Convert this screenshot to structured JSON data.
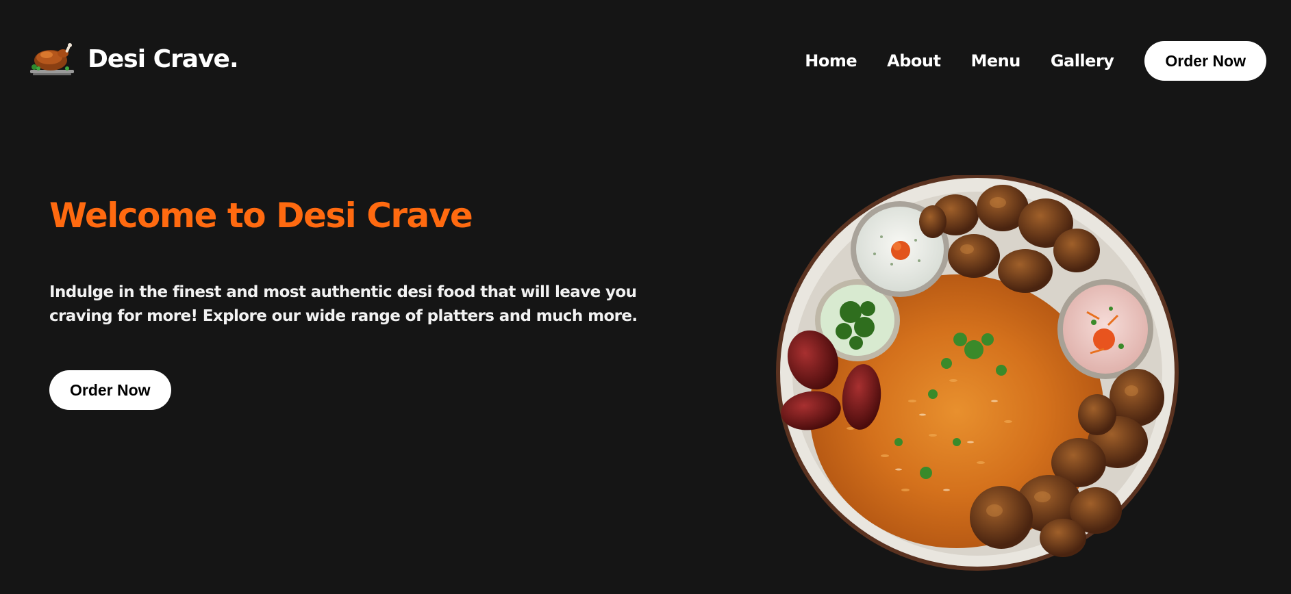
{
  "brand": {
    "logo_icon": "roast-chicken-icon",
    "name": "Desi Crave."
  },
  "nav": {
    "items": [
      {
        "label": "Home"
      },
      {
        "label": "About"
      },
      {
        "label": "Menu"
      },
      {
        "label": "Gallery"
      }
    ],
    "cta_label": "Order Now"
  },
  "hero": {
    "title": "Welcome to Desi Crave",
    "description": "Indulge in the finest and most authentic desi food that will leave you craving for more! Explore our wide range of platters and much more.",
    "cta_label": "Order Now",
    "image_icon": "biryani-platter-image"
  },
  "colors": {
    "background": "#151515",
    "accent": "#ff6a10",
    "button_bg": "#ffffff",
    "button_text": "#000000"
  }
}
